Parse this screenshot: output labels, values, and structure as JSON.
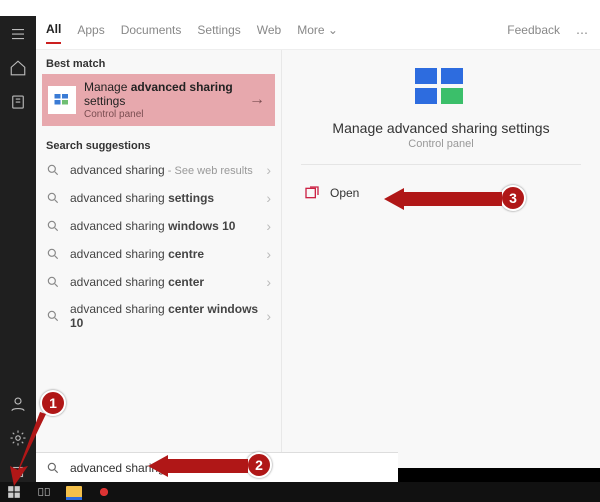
{
  "tabs": {
    "all": "All",
    "apps": "Apps",
    "documents": "Documents",
    "settings": "Settings",
    "web": "Web",
    "more": "More",
    "feedback": "Feedback"
  },
  "sections": {
    "best_match": "Best match",
    "suggestions": "Search suggestions"
  },
  "best_match": {
    "title_prefix": "Manage ",
    "title_bold": "advanced sharing",
    "title_suffix": " settings",
    "subtitle": "Control panel"
  },
  "suggestions": [
    {
      "prefix": "advanced sharing",
      "bold": "",
      "web_hint": " - See web results"
    },
    {
      "prefix": "advanced sharing ",
      "bold": "settings",
      "web_hint": ""
    },
    {
      "prefix": "advanced sharing ",
      "bold": "windows 10",
      "web_hint": ""
    },
    {
      "prefix": "advanced sharing ",
      "bold": "centre",
      "web_hint": ""
    },
    {
      "prefix": "advanced sharing ",
      "bold": "center",
      "web_hint": ""
    },
    {
      "prefix": "advanced sharing ",
      "bold": "center windows 10",
      "web_hint": ""
    }
  ],
  "detail": {
    "title": "Manage advanced sharing settings",
    "subtitle": "Control panel",
    "open": "Open"
  },
  "search": {
    "value": "advanced sharing"
  },
  "annotations": {
    "one": "1",
    "two": "2",
    "three": "3"
  }
}
